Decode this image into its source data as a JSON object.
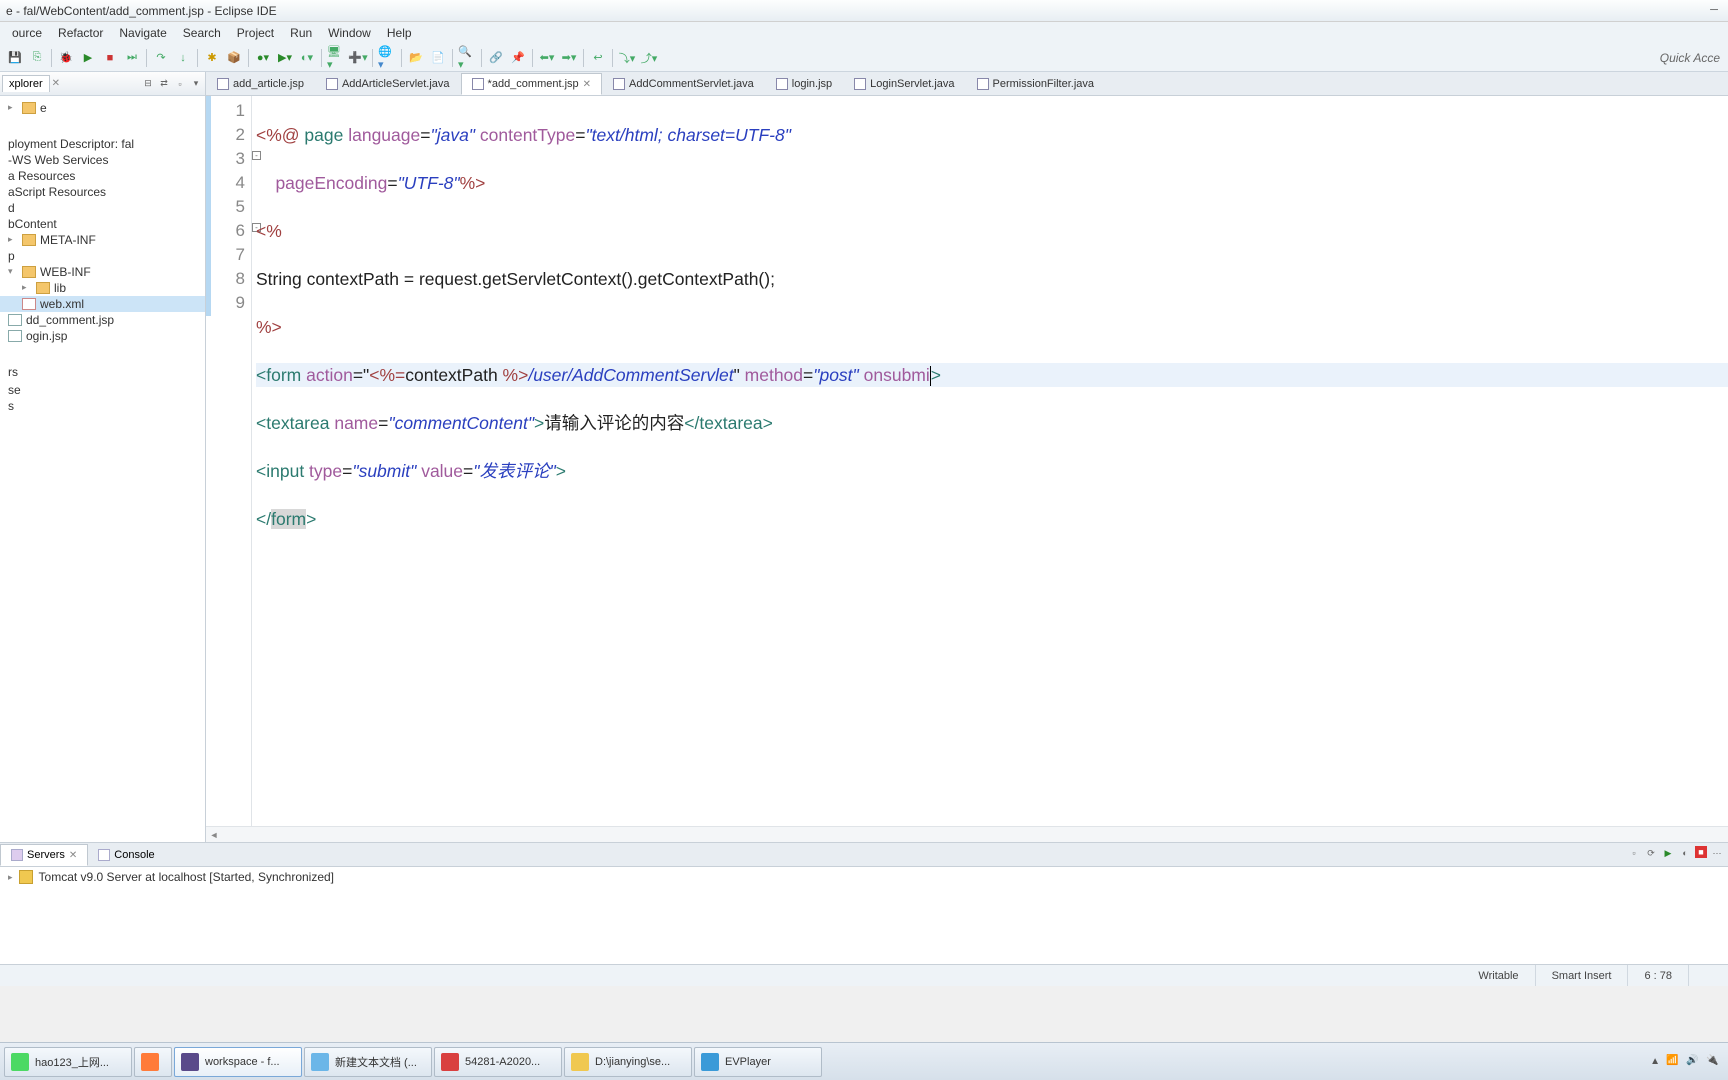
{
  "window": {
    "title": "e - fal/WebContent/add_comment.jsp - Eclipse IDE"
  },
  "menu": [
    "ource",
    "Refactor",
    "Navigate",
    "Search",
    "Project",
    "Run",
    "Window",
    "Help"
  ],
  "quick_access": "Quick Acce",
  "explorer": {
    "title": "xplorer",
    "items": [
      {
        "label": "e",
        "icon": "folder",
        "expand": "▸"
      },
      {
        "label": "",
        "sep": true
      },
      {
        "label": "ployment Descriptor: fal",
        "icon": ""
      },
      {
        "label": "-WS Web Services",
        "icon": ""
      },
      {
        "label": "a Resources",
        "icon": ""
      },
      {
        "label": "aScript Resources",
        "icon": ""
      },
      {
        "label": "d",
        "icon": ""
      },
      {
        "label": "bContent",
        "icon": ""
      },
      {
        "label": "META-INF",
        "icon": "folder",
        "expand": "▸"
      },
      {
        "label": "p",
        "icon": ""
      },
      {
        "label": "WEB-INF",
        "icon": "folder",
        "expand": "▾"
      },
      {
        "label": "lib",
        "icon": "folder",
        "indent": 1,
        "expand": "▸"
      },
      {
        "label": "web.xml",
        "icon": "xml",
        "indent": 1,
        "sel": true
      },
      {
        "label": "dd_comment.jsp",
        "icon": "file"
      },
      {
        "label": "ogin.jsp",
        "icon": "file"
      },
      {
        "label": "",
        "sep": true
      },
      {
        "label": "rs",
        "icon": ""
      },
      {
        "label": "",
        "icon": ""
      },
      {
        "label": "se",
        "icon": ""
      },
      {
        "label": "s",
        "icon": ""
      }
    ]
  },
  "editor_tabs": [
    {
      "label": "add_article.jsp",
      "active": false
    },
    {
      "label": "AddArticleServlet.java",
      "active": false
    },
    {
      "label": "*add_comment.jsp",
      "active": true
    },
    {
      "label": "AddCommentServlet.java",
      "active": false
    },
    {
      "label": "login.jsp",
      "active": false
    },
    {
      "label": "LoginServlet.java",
      "active": false
    },
    {
      "label": "PermissionFilter.java",
      "active": false
    }
  ],
  "code": {
    "l1_a": "<%@ ",
    "l1_b": "page ",
    "l1_c": "language",
    "l1_d": "=",
    "l1_e": "\"java\"",
    "l1_f": " contentType",
    "l1_g": "=",
    "l1_h": "\"text/html; charset=UTF-8\"",
    "l2_a": "    pageEncoding",
    "l2_b": "=",
    "l2_c": "\"UTF-8\"",
    "l2_d": "%>",
    "l3": "<%",
    "l4": "String contextPath = request.getServletContext().getContextPath();",
    "l5": "%>",
    "l6_a": "<",
    "l6_b": "form ",
    "l6_c": "action",
    "l6_d": "=\"",
    "l6_e": "<%=",
    "l6_f": "contextPath ",
    "l6_g": "%>",
    "l6_h": "/user/AddCommentServlet",
    "l6_i": "\" ",
    "l6_j": "method",
    "l6_k": "=",
    "l6_l": "\"post\"",
    "l6_m": " onsubmi",
    "l6_n": ">",
    "l7_a": "<",
    "l7_b": "textarea ",
    "l7_c": "name",
    "l7_d": "=",
    "l7_e": "\"commentContent\"",
    "l7_f": ">",
    "l7_g": "请输入评论的内容",
    "l7_h": "</",
    "l7_i": "textarea",
    "l7_j": ">",
    "l8_a": "<",
    "l8_b": "input ",
    "l8_c": "type",
    "l8_d": "=",
    "l8_e": "\"submit\"",
    "l8_f": " value",
    "l8_g": "=",
    "l8_h": "\"发表评论\"",
    "l8_i": ">",
    "l9_a": "</",
    "l9_b": "form",
    "l9_c": ">"
  },
  "line_numbers": [
    "1",
    "2",
    "3",
    "4",
    "5",
    "6",
    "7",
    "8",
    "9"
  ],
  "bottom": {
    "tabs": [
      {
        "label": "Servers",
        "active": true
      },
      {
        "label": "Console",
        "active": false
      }
    ],
    "server": "Tomcat v9.0 Server at localhost  [Started, Synchronized]"
  },
  "status": {
    "writable": "Writable",
    "insert": "Smart Insert",
    "pos": "6 : 78"
  },
  "taskbar": [
    {
      "label": "hao123_上网...",
      "color": "#4cd964"
    },
    {
      "label": "",
      "color": "#ff7b3a",
      "narrow": true
    },
    {
      "label": "workspace - f...",
      "color": "#5a4a8a",
      "active": true
    },
    {
      "label": "新建文本文档 (...",
      "color": "#6bb6e8"
    },
    {
      "label": "54281-A2020...",
      "color": "#d94040"
    },
    {
      "label": "D:\\jianying\\se...",
      "color": "#f0c850"
    },
    {
      "label": "EVPlayer",
      "color": "#3a9ad8"
    }
  ]
}
